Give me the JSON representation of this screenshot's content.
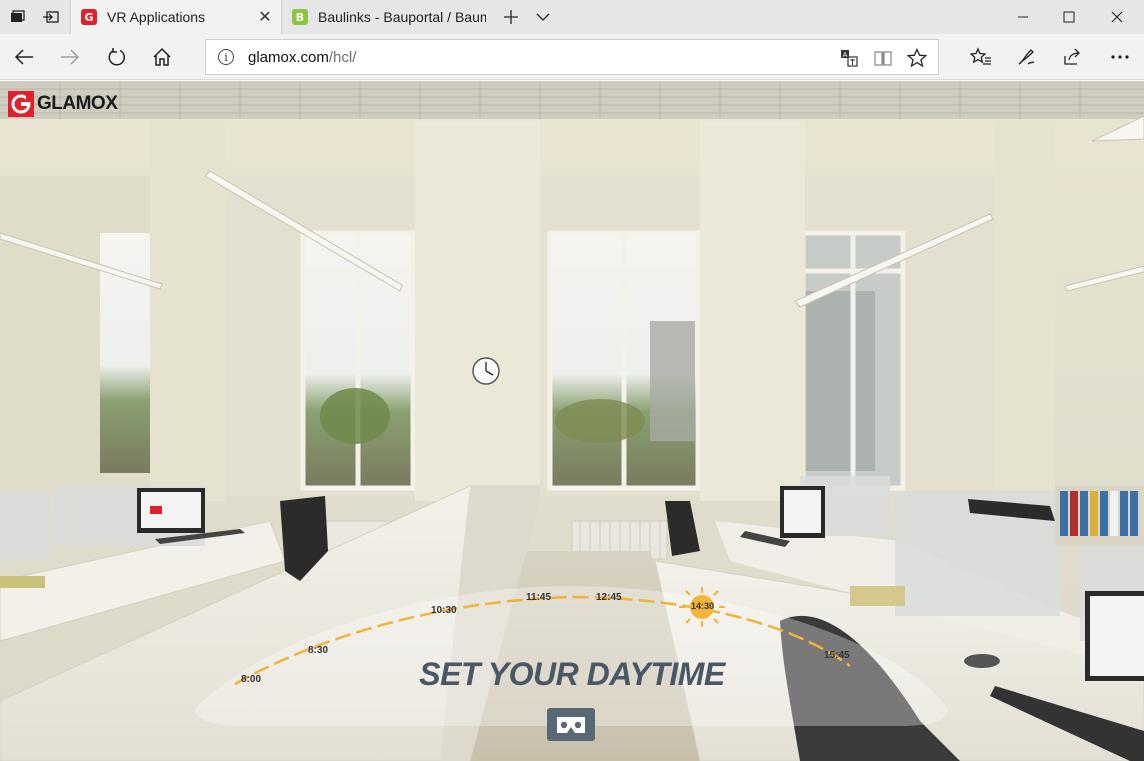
{
  "tabbar": {
    "tabs": [
      {
        "title": "VR Applications",
        "favicon_letter": "G",
        "favicon_color": "#e0202a",
        "active": true
      },
      {
        "title": "Baulinks - Bauportal / Baum",
        "favicon_letter": "B",
        "favicon_color": "#8cc63f",
        "active": false
      }
    ]
  },
  "address": {
    "domain": "glamox.com",
    "path": "/hcl/"
  },
  "page": {
    "logo_text": "GLAMOX",
    "title": "SET YOUR DAYTIME",
    "times": [
      "8:00",
      "8:30",
      "10:30",
      "11:45",
      "12:45",
      "14:30",
      "15:45"
    ],
    "selected_time": "14:30",
    "accent_color": "#f0b43c"
  }
}
